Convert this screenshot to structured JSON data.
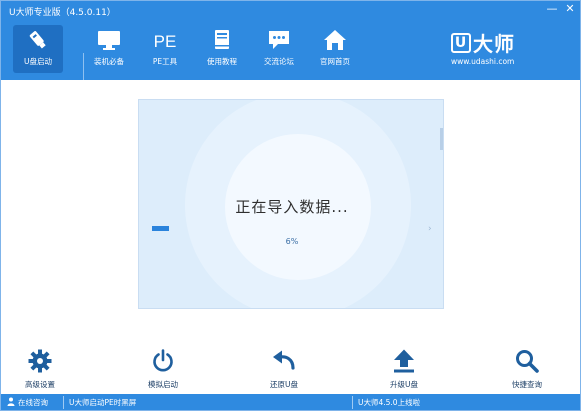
{
  "window": {
    "title": "U大师专业版（4.5.0.11）",
    "minimize_glyph": "—",
    "close_glyph": "✕"
  },
  "nav": {
    "items": [
      {
        "label": "U盘启动",
        "icon": "usb-drive-icon",
        "active": true
      },
      {
        "label": "装机必备",
        "icon": "monitor-icon"
      },
      {
        "label": "PE工具",
        "icon": "pe-text-icon",
        "icon_text": "PE"
      },
      {
        "label": "使用教程",
        "icon": "book-icon"
      },
      {
        "label": "交流论坛",
        "icon": "chat-bubble-icon"
      },
      {
        "label": "官网首页",
        "icon": "home-icon"
      }
    ]
  },
  "brand": {
    "logo_u": "U",
    "logo_text": "大师",
    "url": "www.udashi.com"
  },
  "progress": {
    "title": "正在导入数据...",
    "percent_text": "6%",
    "percent": 6
  },
  "toolbar": {
    "items": [
      {
        "label": "高级设置",
        "icon": "gear-icon"
      },
      {
        "label": "模拟启动",
        "icon": "power-icon"
      },
      {
        "label": "还原U盘",
        "icon": "undo-arrow-icon"
      },
      {
        "label": "升级U盘",
        "icon": "upload-arrow-icon"
      },
      {
        "label": "快捷查询",
        "icon": "search-icon"
      }
    ]
  },
  "status": {
    "online_consult": "在线咨询",
    "notice": "U大师启动PE时黑屏",
    "release": "U大师4.5.0上线啦"
  },
  "colors": {
    "header_blue": "#2f8ae0",
    "active_tab": "#1f6fc2",
    "progress_fill": "#2a83dc",
    "toolbar_icon": "#1f5f9e"
  }
}
